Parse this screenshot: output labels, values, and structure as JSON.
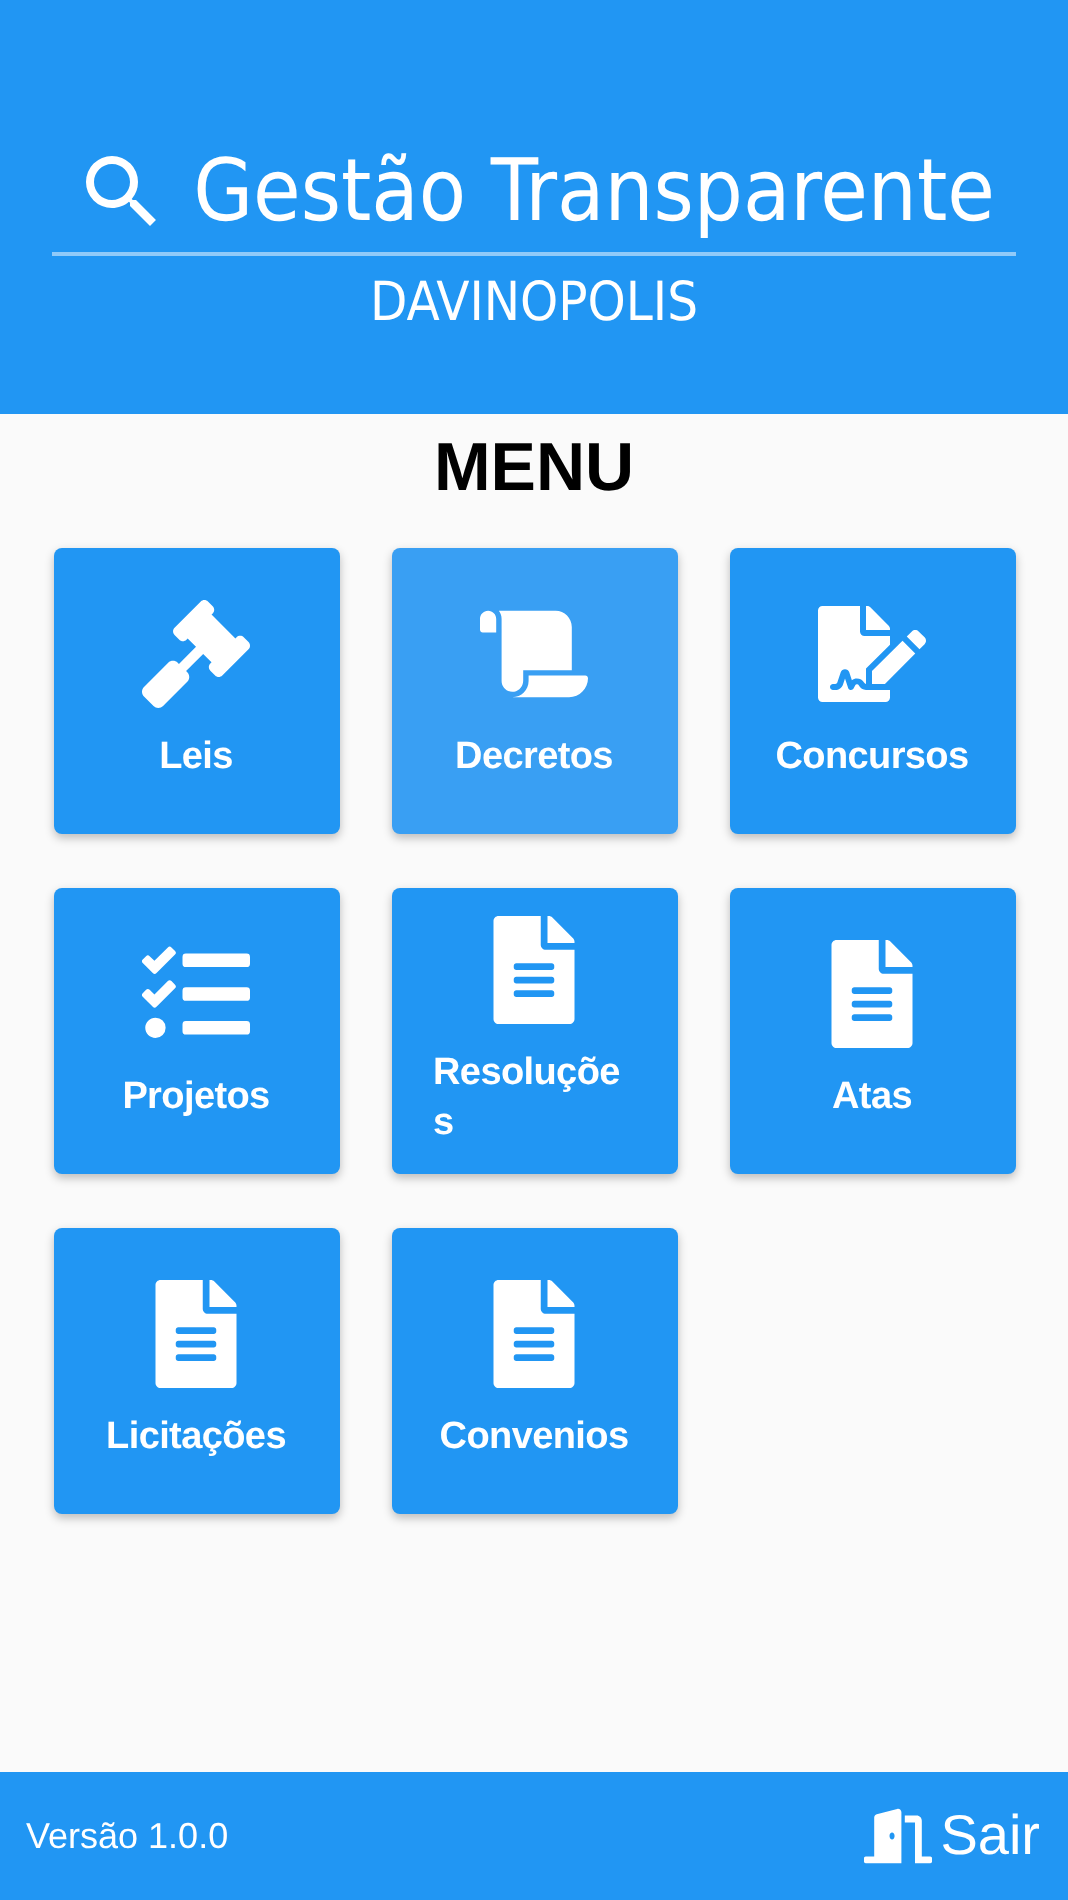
{
  "header": {
    "title": "Gestão Transparente",
    "subtitle": "DAVINOPOLIS"
  },
  "menu": {
    "title": "MENU",
    "items": [
      {
        "label": "Leis",
        "kind": "gavel",
        "selected": false
      },
      {
        "label": "Decretos",
        "kind": "scroll",
        "selected": true
      },
      {
        "label": "Concursos",
        "kind": "signature",
        "selected": false
      },
      {
        "label": "Projetos",
        "kind": "checklist",
        "selected": false
      },
      {
        "label": "Resoluções",
        "kind": "document",
        "selected": false
      },
      {
        "label": "Atas",
        "kind": "document",
        "selected": false
      },
      {
        "label": "Licitações",
        "kind": "document",
        "selected": false
      },
      {
        "label": "Convenios",
        "kind": "document",
        "selected": false
      }
    ]
  },
  "footer": {
    "version": "Versão 1.0.0",
    "logout": "Sair"
  }
}
